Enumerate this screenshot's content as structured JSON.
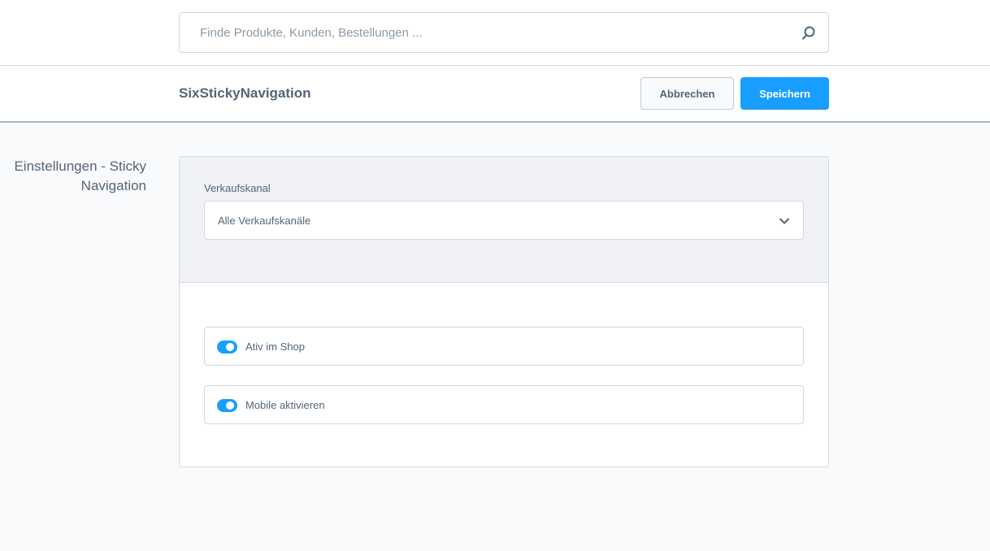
{
  "search": {
    "placeholder": "Finde Produkte, Kunden, Bestellungen ...",
    "value": ""
  },
  "smart_bar": {
    "title": "SixStickyNavigation",
    "cancel_label": "Abbrechen",
    "save_label": "Speichern"
  },
  "section": {
    "label": "Einstellungen - Sticky Navigation"
  },
  "sales_channel": {
    "label": "Verkaufskanal",
    "selected": "Alle Verkaufskanäle"
  },
  "switches": [
    {
      "label": "Ativ im Shop",
      "checked": true
    },
    {
      "label": "Mobile aktivieren",
      "checked": true
    }
  ],
  "colors": {
    "accent": "#189eff",
    "text": "#52667a",
    "border": "#d1d9e0",
    "page_background": "#f9fafb",
    "card_header_background": "#f0f2f5"
  },
  "icons": {
    "search": "search-icon",
    "select": "chevron-down-icon"
  }
}
